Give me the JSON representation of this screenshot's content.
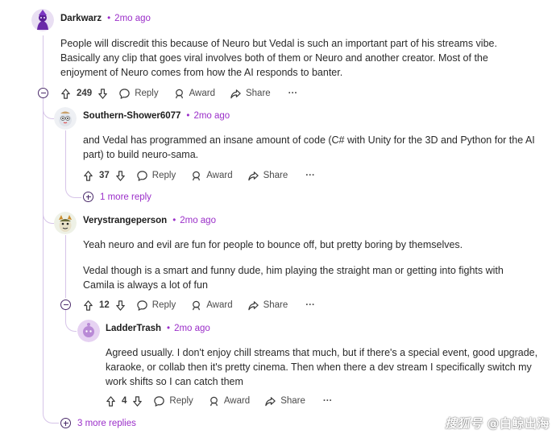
{
  "comments": [
    {
      "username": "Darkwarz",
      "time": "2mo ago",
      "paragraphs": [
        "People will discredit this because of Neuro but Vedal is such an important part of his streams vibe. Basically any clip that goes viral involves both of them or Neuro and another creator. Most of the enjoyment of Neuro comes from how the AI responds to banter."
      ],
      "votes": "249"
    },
    {
      "username": "Southern-Shower6077",
      "time": "2mo ago",
      "paragraphs": [
        "and Vedal has programmed an insane amount of code (C# with Unity for the 3D and Python for the AI part) to build neuro-sama."
      ],
      "votes": "37"
    },
    {
      "username": "Verystrangeperson",
      "time": "2mo ago",
      "paragraphs": [
        "Yeah neuro and evil are fun for people to bounce off, but pretty boring by themselves.",
        "Vedal though is a smart and funny dude, him playing the straight man or getting into fights with Camila is always a lot of fun"
      ],
      "votes": "12"
    },
    {
      "username": "LadderTrash",
      "time": "2mo ago",
      "paragraphs": [
        "Agreed usually. I don't enjoy chill streams that much, but if there's a special event, good upgrade, karaoke, or collab then it's pretty cinema. Then when there a dev stream I specifically switch my work shifts so I can catch them"
      ],
      "votes": "4"
    }
  ],
  "actions": {
    "reply": "Reply",
    "award": "Award",
    "share": "Share",
    "overflow": "···"
  },
  "more_replies": {
    "southern": "1 more reply",
    "thread": "3 more replies"
  },
  "meta_dot": "•",
  "watermark": {
    "left": "搜狐号",
    "right": "@白鲸出海"
  },
  "colors": {
    "accent": "#9b2fc9",
    "thread_line": "#d6c4e8",
    "text": "#2a2a2a"
  }
}
